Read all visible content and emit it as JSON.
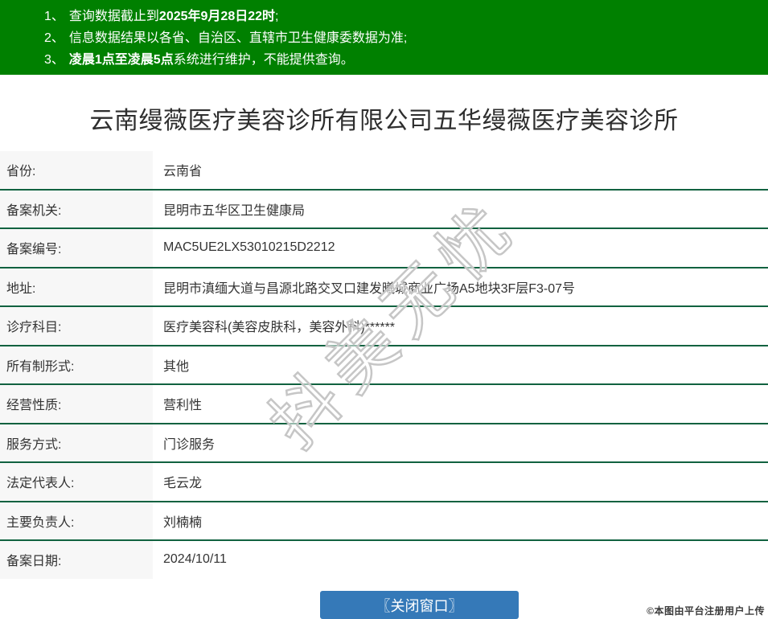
{
  "colors": {
    "banner_green": "#008000",
    "divider_green": "#116240",
    "button_blue": "#3579b8",
    "label_bg": "#f7f7f7",
    "text": "#333333"
  },
  "notices": [
    {
      "num": "1、",
      "segments": [
        {
          "text": "查询数据截止到",
          "bold": false
        },
        {
          "text": "2025年9月28日22时",
          "bold": true
        },
        {
          "text": ";",
          "bold": false
        }
      ]
    },
    {
      "num": "2、",
      "segments": [
        {
          "text": "信息数据结果以各省、自治区、直辖市卫生健康委数据为准;",
          "bold": false
        }
      ]
    },
    {
      "num": "3、",
      "segments": [
        {
          "text": "凌晨1点至凌晨5点",
          "bold": true
        },
        {
          "text": "系统进行维护，不能提供查询。",
          "bold": false
        }
      ]
    }
  ],
  "title": "云南缦薇医疗美容诊所有限公司五华缦薇医疗美容诊所",
  "table": {
    "rows": [
      {
        "label": "省份:",
        "value": "云南省"
      },
      {
        "label": "备案机关:",
        "value": "昆明市五华区卫生健康局"
      },
      {
        "label": "备案编号:",
        "value": "MAC5UE2LX53010215D2212"
      },
      {
        "label": "地址:",
        "value": "昆明市滇缅大道与昌源北路交叉口建发曦城商业广场A5地块3F层F3-07号"
      },
      {
        "label": "诊疗科目:",
        "value": "医疗美容科(美容皮肤科，美容外科)******"
      },
      {
        "label": "所有制形式:",
        "value": "其他"
      },
      {
        "label": "经营性质:",
        "value": "营利性"
      },
      {
        "label": "服务方式:",
        "value": "门诊服务"
      },
      {
        "label": "法定代表人:",
        "value": "毛云龙"
      },
      {
        "label": "主要负责人:",
        "value": "刘楠楠"
      },
      {
        "label": "备案日期:",
        "value": "2024/10/11"
      }
    ]
  },
  "watermark": "抖美无忧",
  "close_button_label": "〖关闭窗口〗",
  "attribution": "©本图由平台注册用户上传"
}
